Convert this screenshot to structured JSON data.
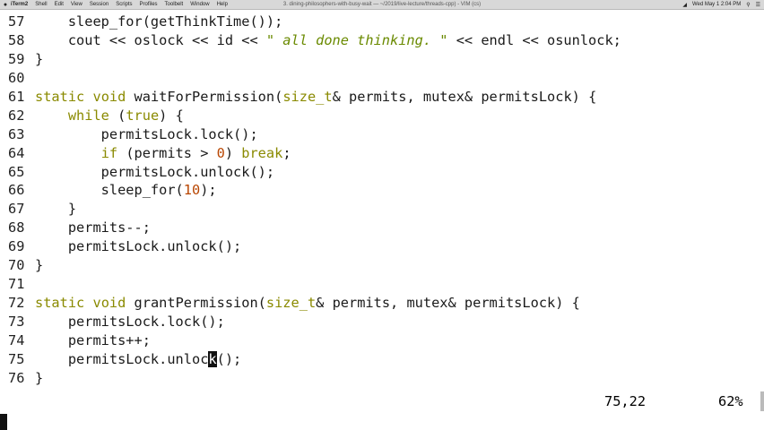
{
  "menubar": {
    "items": [
      "iTerm2",
      "Shell",
      "Edit",
      "View",
      "Session",
      "Scripts",
      "Profiles",
      "Toolbelt",
      "Window",
      "Help"
    ],
    "title": "3. dining-philosophers-with-busy-wait — ~/2019/live-lecture/threads-cpp) - VIM (cs)",
    "clock": "Wed May 1 2:04 PM"
  },
  "code_lines": [
    {
      "n": "57",
      "t": "    sleep_for(getThinkTime());"
    },
    {
      "n": "58",
      "t": "    cout << oslock << id << \" all done thinking. \" << endl << osunlock;"
    },
    {
      "n": "59",
      "t": "}"
    },
    {
      "n": "60",
      "t": ""
    },
    {
      "n": "61",
      "t": "static void waitForPermission(size_t& permits, mutex& permitsLock) {"
    },
    {
      "n": "62",
      "t": "    while (true) {"
    },
    {
      "n": "63",
      "t": "        permitsLock.lock();"
    },
    {
      "n": "64",
      "t": "        if (permits > 0) break;"
    },
    {
      "n": "65",
      "t": "        permitsLock.unlock();"
    },
    {
      "n": "66",
      "t": "        sleep_for(10);"
    },
    {
      "n": "67",
      "t": "    }"
    },
    {
      "n": "68",
      "t": "    permits--;"
    },
    {
      "n": "69",
      "t": "    permitsLock.unlock();"
    },
    {
      "n": "70",
      "t": "}"
    },
    {
      "n": "71",
      "t": ""
    },
    {
      "n": "72",
      "t": "static void grantPermission(size_t& permits, mutex& permitsLock) {"
    },
    {
      "n": "73",
      "t": "    permitsLock.lock();"
    },
    {
      "n": "74",
      "t": "    permits++;"
    },
    {
      "n": "75",
      "t": "    permitsLock.unlock();"
    },
    {
      "n": "76",
      "t": "}"
    }
  ],
  "ruler": {
    "position": "75,22",
    "percent": "62%"
  },
  "colors": {
    "keyword": "#8a8a00",
    "string": "#6a8a00",
    "number": "#b84500"
  }
}
